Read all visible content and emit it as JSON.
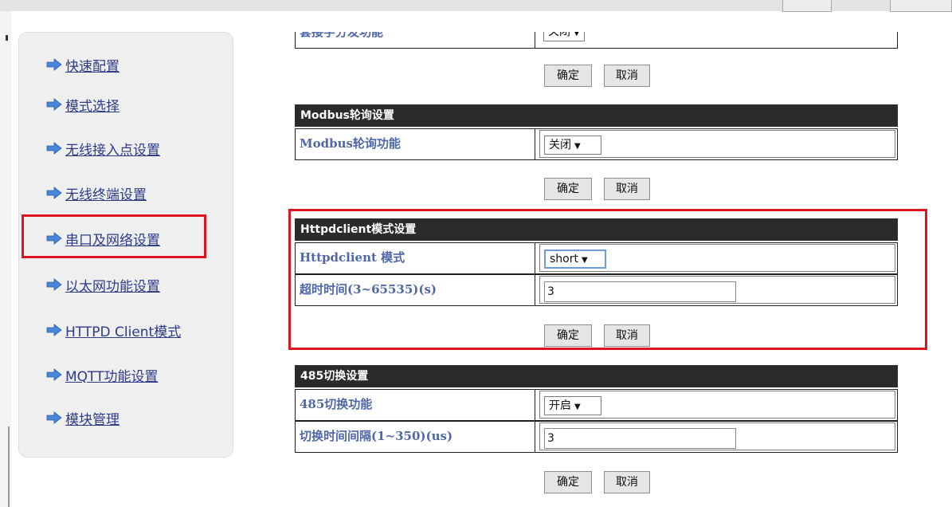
{
  "sidebar": {
    "items": [
      {
        "label": "快速配置"
      },
      {
        "label": "模式选择"
      },
      {
        "label": "无线接入点设置"
      },
      {
        "label": "无线终端设置"
      },
      {
        "label": "串口及网络设置"
      },
      {
        "label": "以太网功能设置"
      },
      {
        "label": "HTTPD Client模式"
      },
      {
        "label": "MQTT功能设置"
      },
      {
        "label": "模块管理"
      }
    ]
  },
  "sections": {
    "partial": {
      "label": "套接字分发功能",
      "value": "关闭",
      "ok": "确定",
      "cancel": "取消"
    },
    "modbus": {
      "title": "Modbus轮询设置",
      "label": "Modbus轮询功能",
      "value": "关闭",
      "ok": "确定",
      "cancel": "取消"
    },
    "httpd": {
      "title": "Httpdclient模式设置",
      "mode_label": "Httpdclient 模式",
      "mode_value": "short",
      "timeout_label": "超时时间(3~65535)(s)",
      "timeout_value": "3",
      "ok": "确定",
      "cancel": "取消"
    },
    "rs485": {
      "title": "485切换设置",
      "label": "485切换功能",
      "value": "开启",
      "interval_label": "切换时间间隔(1~350)(us)",
      "interval_value": "3",
      "ok": "确定",
      "cancel": "取消"
    }
  },
  "colors": {
    "highlight": "#e0141e",
    "section_bar": "#2b2b2b",
    "label_text": "#4f66a8",
    "nav_link": "#2d3b8a",
    "arrow": "#4a86d9"
  },
  "icons": {
    "nav_arrow": "arrow-right-icon",
    "select_caret": "caret-down-icon"
  }
}
